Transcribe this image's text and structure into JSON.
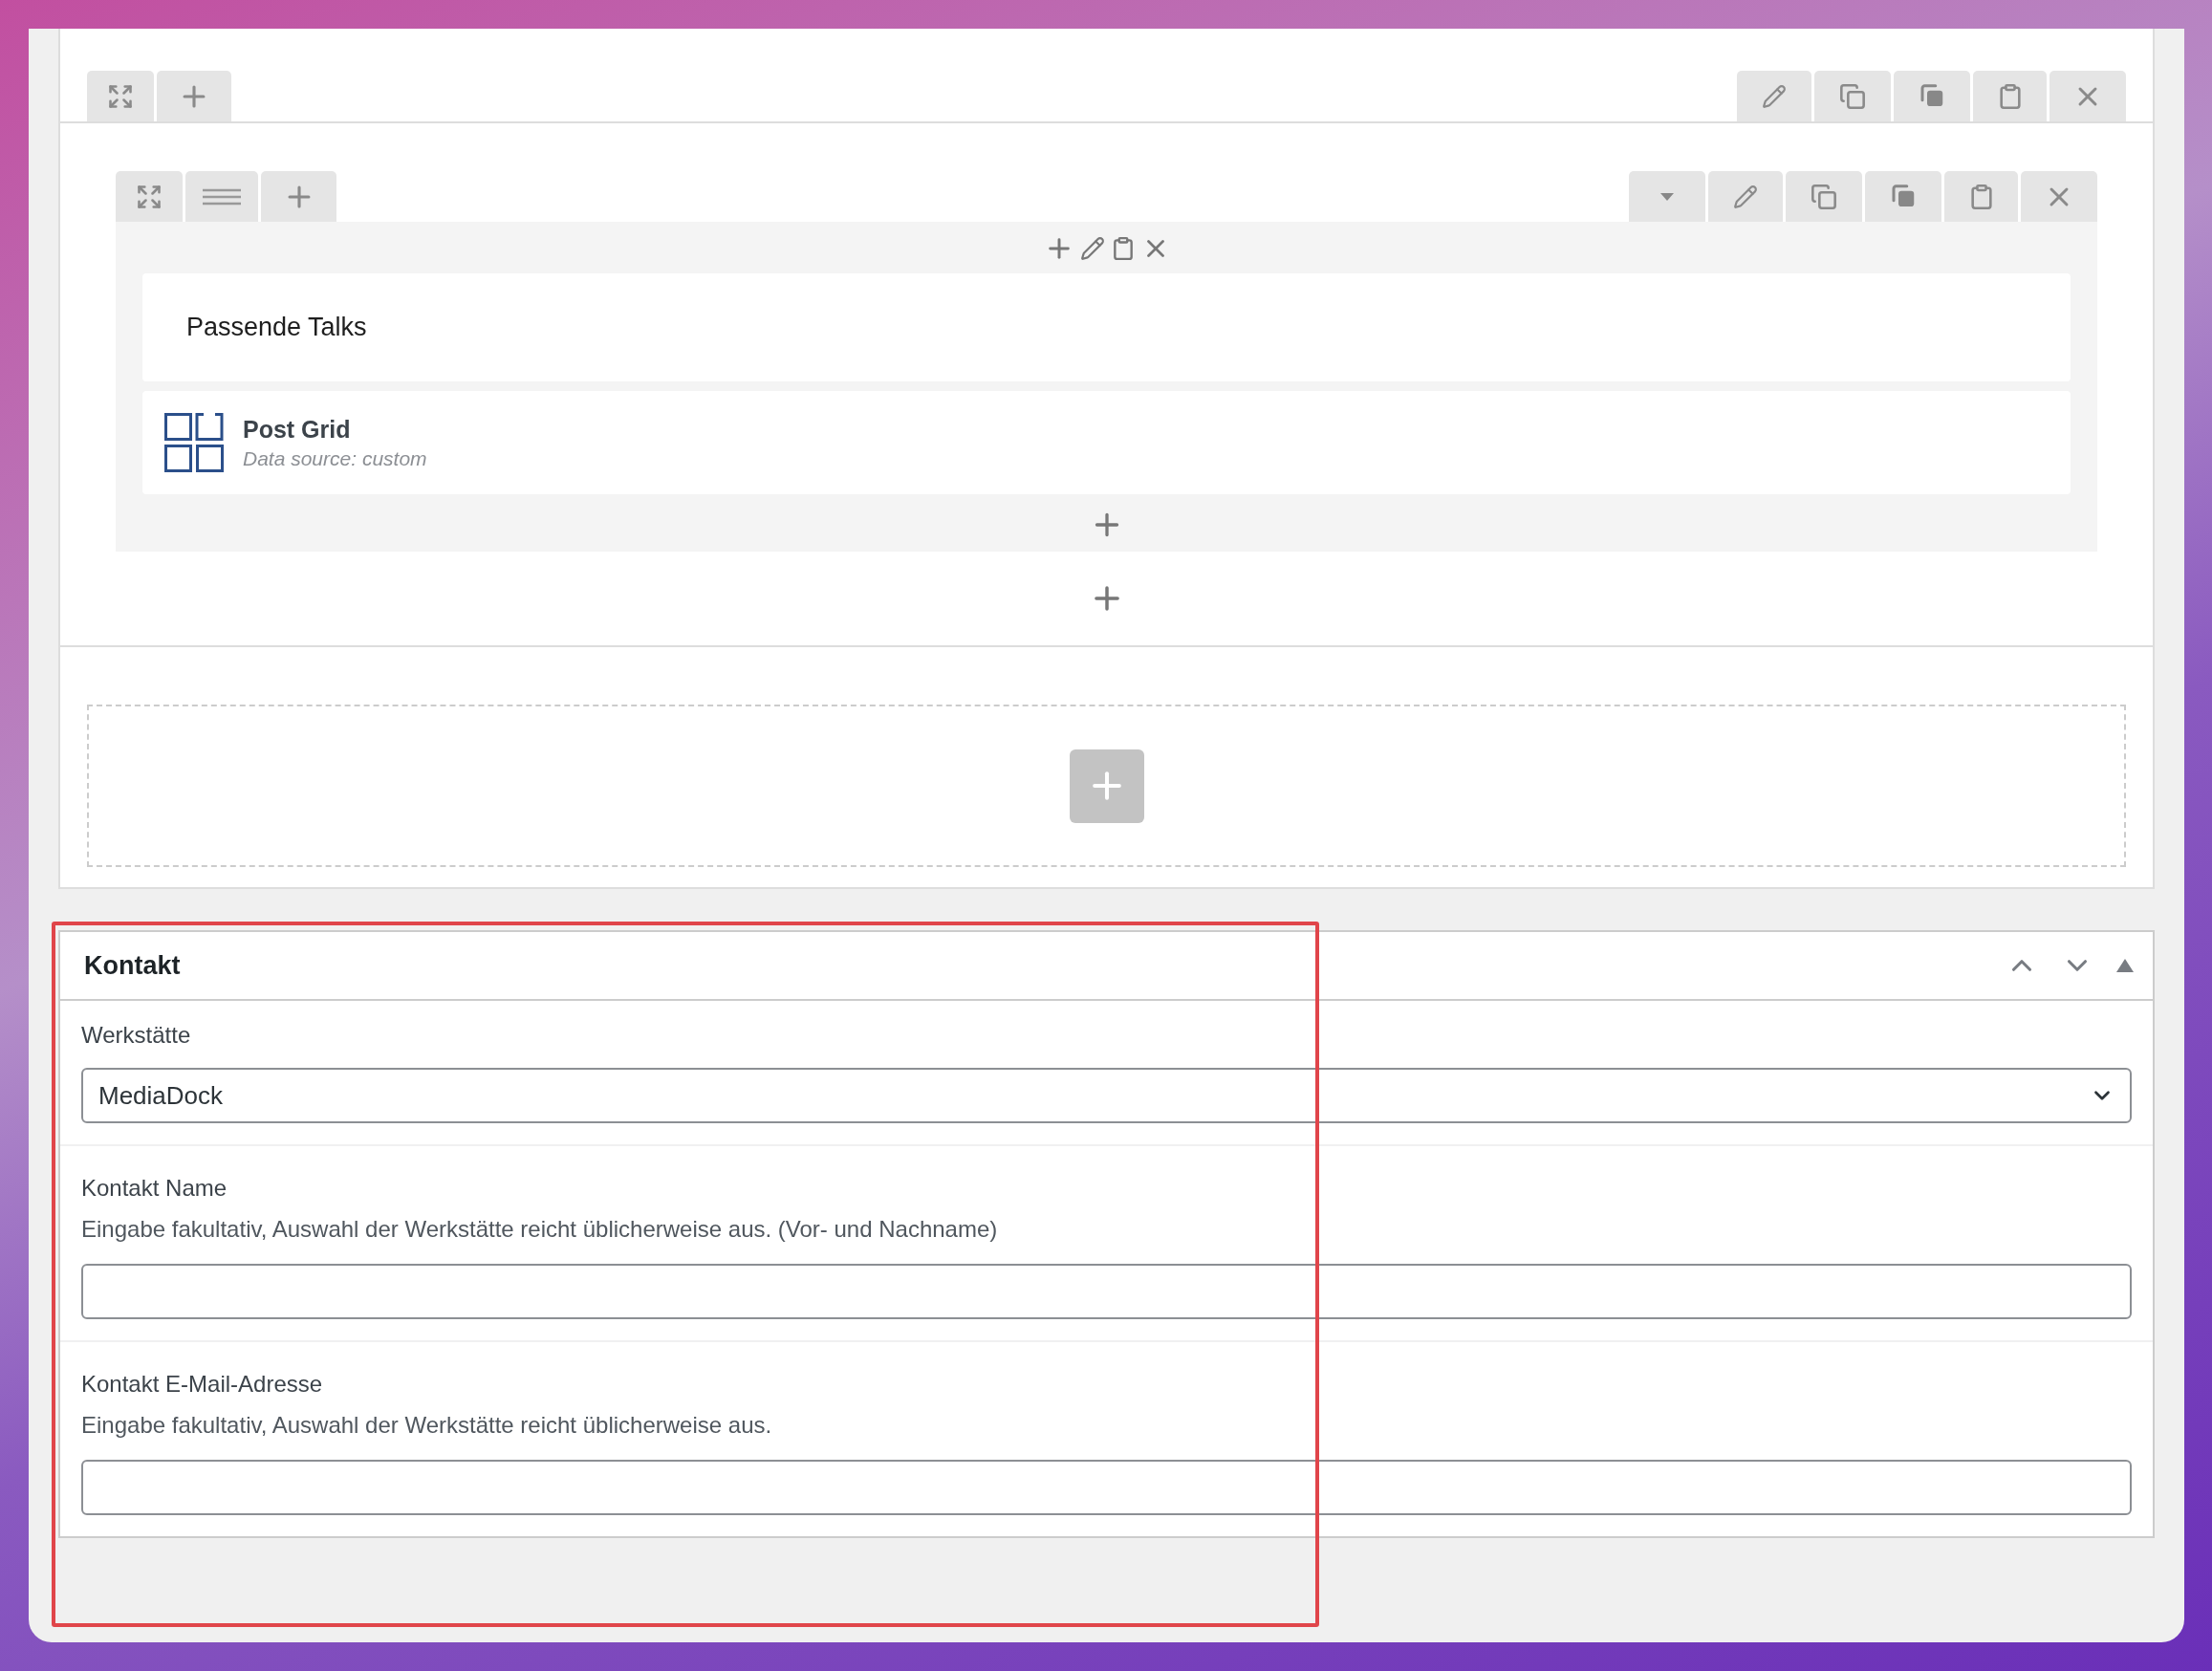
{
  "builder": {
    "modules": [
      {
        "kind": "text",
        "text": "Passende Talks"
      },
      {
        "kind": "post_grid",
        "title": "Post Grid",
        "subtitle": "Data source: custom"
      }
    ]
  },
  "panel": {
    "title": "Kontakt",
    "highlighted": true,
    "fields": [
      {
        "kind": "select",
        "label": "Werkstätte",
        "value": "MediaDock"
      },
      {
        "kind": "text",
        "label": "Kontakt Name",
        "description": "Eingabe fakultativ, Auswahl der Werkstätte reicht üblicherweise aus. (Vor- und Nachname)"
      },
      {
        "kind": "text",
        "label": "Kontakt E-Mail-Adresse",
        "description": "Eingabe fakultativ, Auswahl der Werkstätte reicht üblicherweise aus."
      }
    ]
  }
}
